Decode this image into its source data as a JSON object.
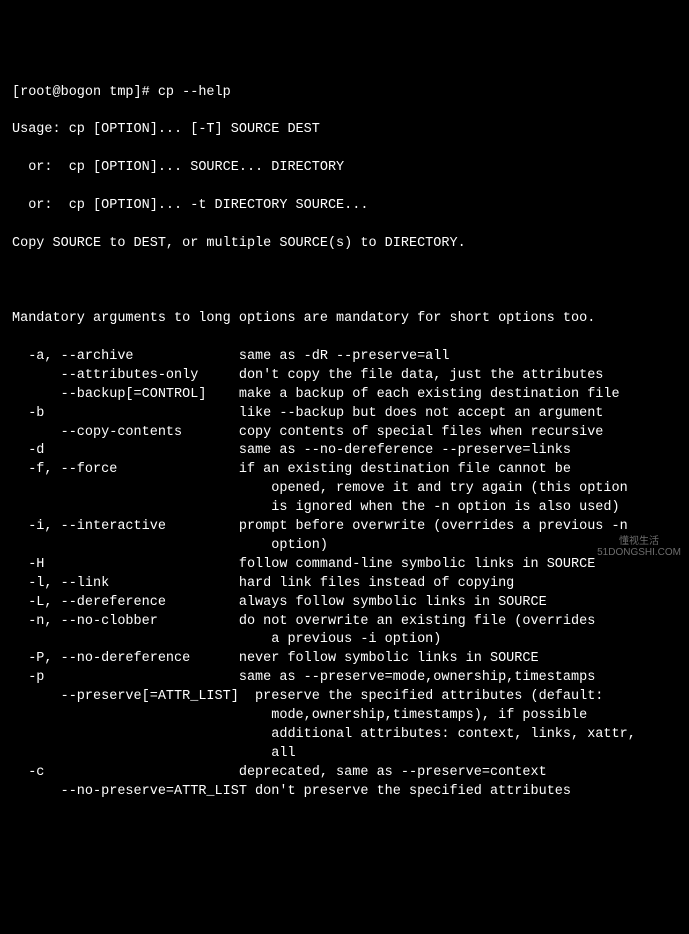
{
  "prompt": "[root@bogon tmp]# cp --help",
  "usage": [
    "Usage: cp [OPTION]... [-T] SOURCE DEST",
    "  or:  cp [OPTION]... SOURCE... DIRECTORY",
    "  or:  cp [OPTION]... -t DIRECTORY SOURCE..."
  ],
  "summary": "Copy SOURCE to DEST, or multiple SOURCE(s) to DIRECTORY.",
  "mandatory_note": "Mandatory arguments to long options are mandatory for short options too.",
  "options": [
    {
      "flag": "  -a, --archive             ",
      "desc": "same as -dR --preserve=all"
    },
    {
      "flag": "      --attributes-only     ",
      "desc": "don't copy the file data, just the attributes"
    },
    {
      "flag": "      --backup[=CONTROL]    ",
      "desc": "make a backup of each existing destination file"
    },
    {
      "flag": "  -b                        ",
      "desc": "like --backup but does not accept an argument"
    },
    {
      "flag": "      --copy-contents       ",
      "desc": "copy contents of special files when recursive"
    },
    {
      "flag": "  -d                        ",
      "desc": "same as --no-dereference --preserve=links"
    },
    {
      "flag": "  -f, --force               ",
      "desc": "if an existing destination file cannot be"
    },
    {
      "flag": "                              ",
      "desc": "  opened, remove it and try again (this option"
    },
    {
      "flag": "                              ",
      "desc": "  is ignored when the -n option is also used)"
    },
    {
      "flag": "  -i, --interactive         ",
      "desc": "prompt before overwrite (overrides a previous -n"
    },
    {
      "flag": "                              ",
      "desc": "  option)"
    },
    {
      "flag": "  -H                        ",
      "desc": "follow command-line symbolic links in SOURCE"
    },
    {
      "flag": "  -l, --link                ",
      "desc": "hard link files instead of copying"
    },
    {
      "flag": "  -L, --dereference         ",
      "desc": "always follow symbolic links in SOURCE"
    },
    {
      "flag": "  -n, --no-clobber          ",
      "desc": "do not overwrite an existing file (overrides"
    },
    {
      "flag": "                              ",
      "desc": "  a previous -i option)"
    },
    {
      "flag": "  -P, --no-dereference      ",
      "desc": "never follow symbolic links in SOURCE"
    },
    {
      "flag": "  -p                        ",
      "desc": "same as --preserve=mode,ownership,timestamps"
    },
    {
      "flag": "      --preserve[=ATTR_LIST]",
      "desc": "  preserve the specified attributes (default:"
    },
    {
      "flag": "                              ",
      "desc": "  mode,ownership,timestamps), if possible"
    },
    {
      "flag": "                              ",
      "desc": "  additional attributes: context, links, xattr,"
    },
    {
      "flag": "                              ",
      "desc": "  all"
    },
    {
      "flag": "  -c                        ",
      "desc": "deprecated, same as --preserve=context"
    },
    {
      "flag": "      --no-preserve=ATTR_LIST",
      "desc": " don't preserve the specified attributes"
    }
  ],
  "watermark": {
    "top": "懂视生活",
    "bottom": "51DONGSHI.COM"
  }
}
